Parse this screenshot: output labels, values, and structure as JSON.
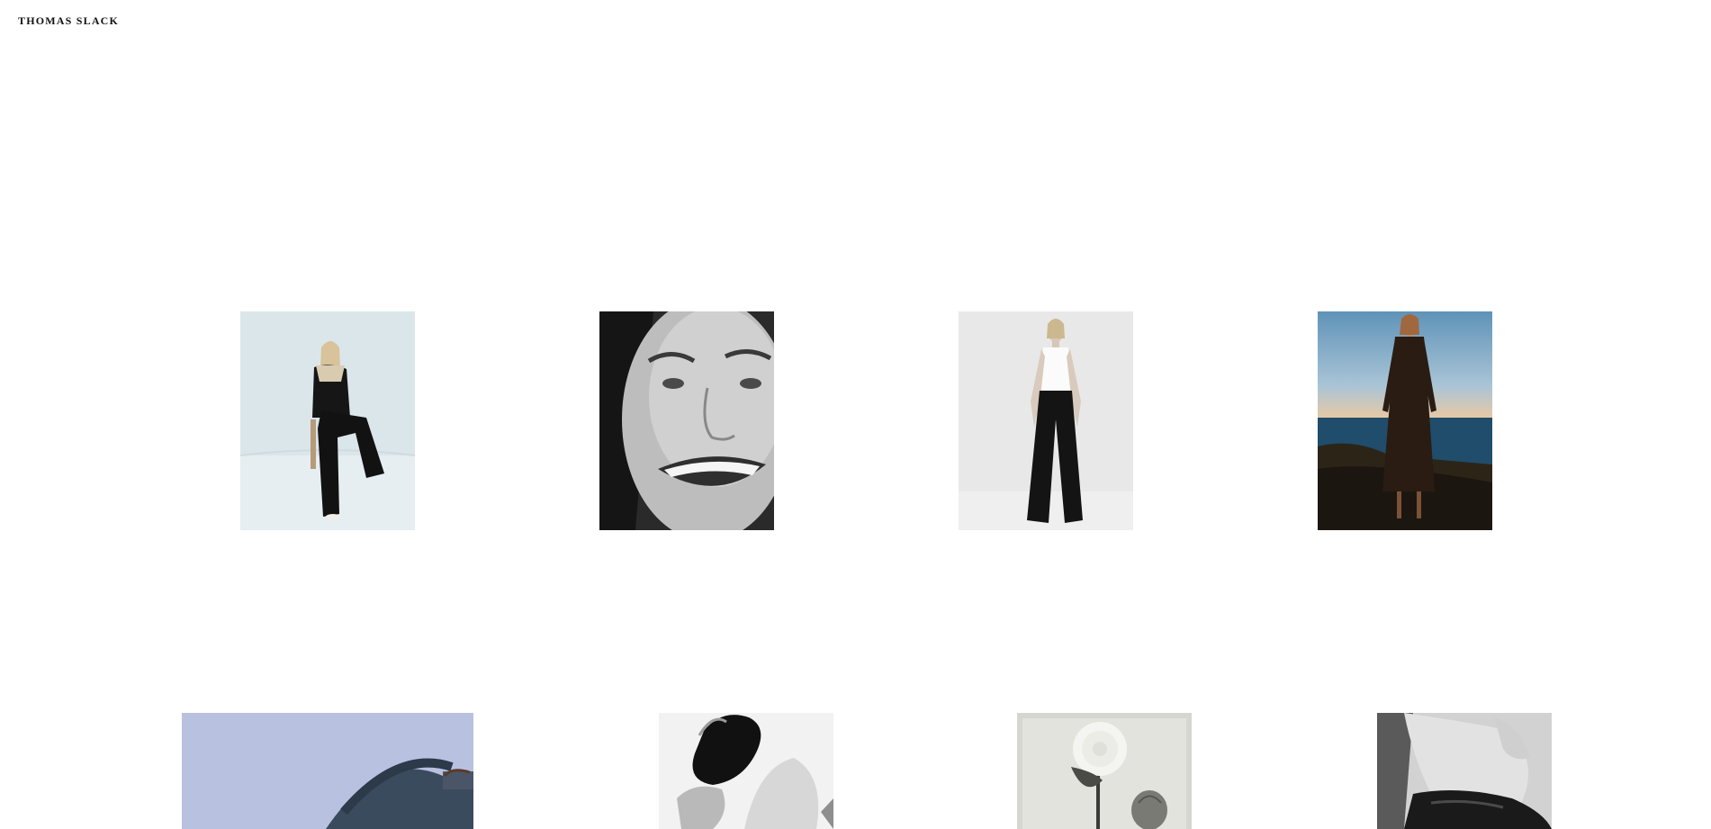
{
  "site": {
    "title": "THOMAS SLACK"
  },
  "gallery": {
    "items": [
      {
        "subject": "seated-model-black-suit",
        "palette": "pale-blue-studio"
      },
      {
        "subject": "smiling-face-closeup",
        "palette": "black-and-white"
      },
      {
        "subject": "standing-model-wide-trousers",
        "palette": "light-grey-studio"
      },
      {
        "subject": "model-coat-by-sea",
        "palette": "blue-sky-ocean"
      },
      {
        "subject": "handbag-against-sky",
        "palette": "lavender-blue"
      },
      {
        "subject": "figure-black-fabric",
        "palette": "black-and-white"
      },
      {
        "subject": "dahlia-flower-still-life",
        "palette": "grey-monochrome"
      },
      {
        "subject": "crouching-figure-leather",
        "palette": "black-and-white"
      }
    ]
  },
  "colors": {
    "background": "#ffffff",
    "text": "#111111"
  }
}
